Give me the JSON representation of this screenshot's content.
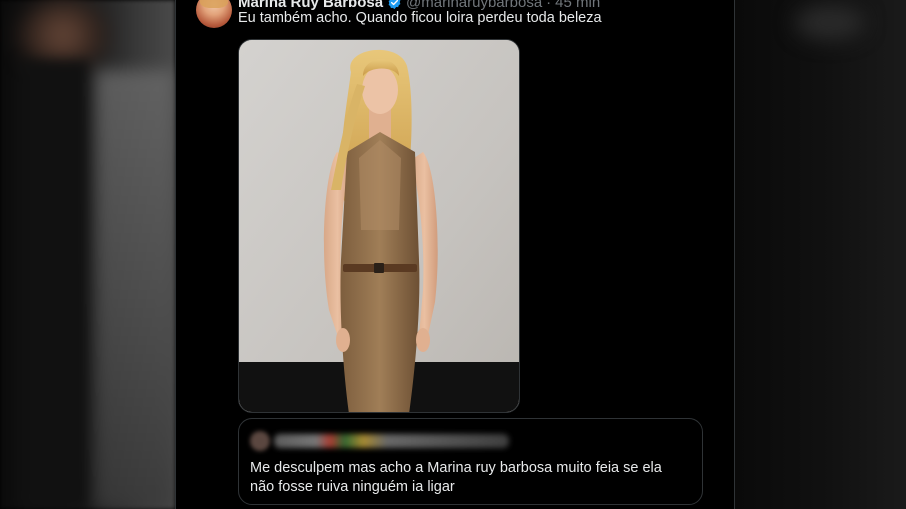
{
  "tweet": {
    "display_name": "Marina Ruy Barbosa",
    "handle": "@marinaruybarbosa",
    "separator": "·",
    "time": "45 min",
    "text": "Eu também acho. Quando ficou loira perdeu toda beleza"
  },
  "quoted_tweet": {
    "text": "Me desculpem mas acho a Marina ruy barbosa muito feia se ela não fosse ruiva ninguém ia ligar"
  },
  "colors": {
    "background": "#000000",
    "text_primary": "#e7e9ea",
    "text_secondary": "#71767b",
    "border": "#2f3336",
    "verified": "#1d9bf0"
  },
  "icons": [
    "verified-badge-icon",
    "more-options-icon"
  ]
}
